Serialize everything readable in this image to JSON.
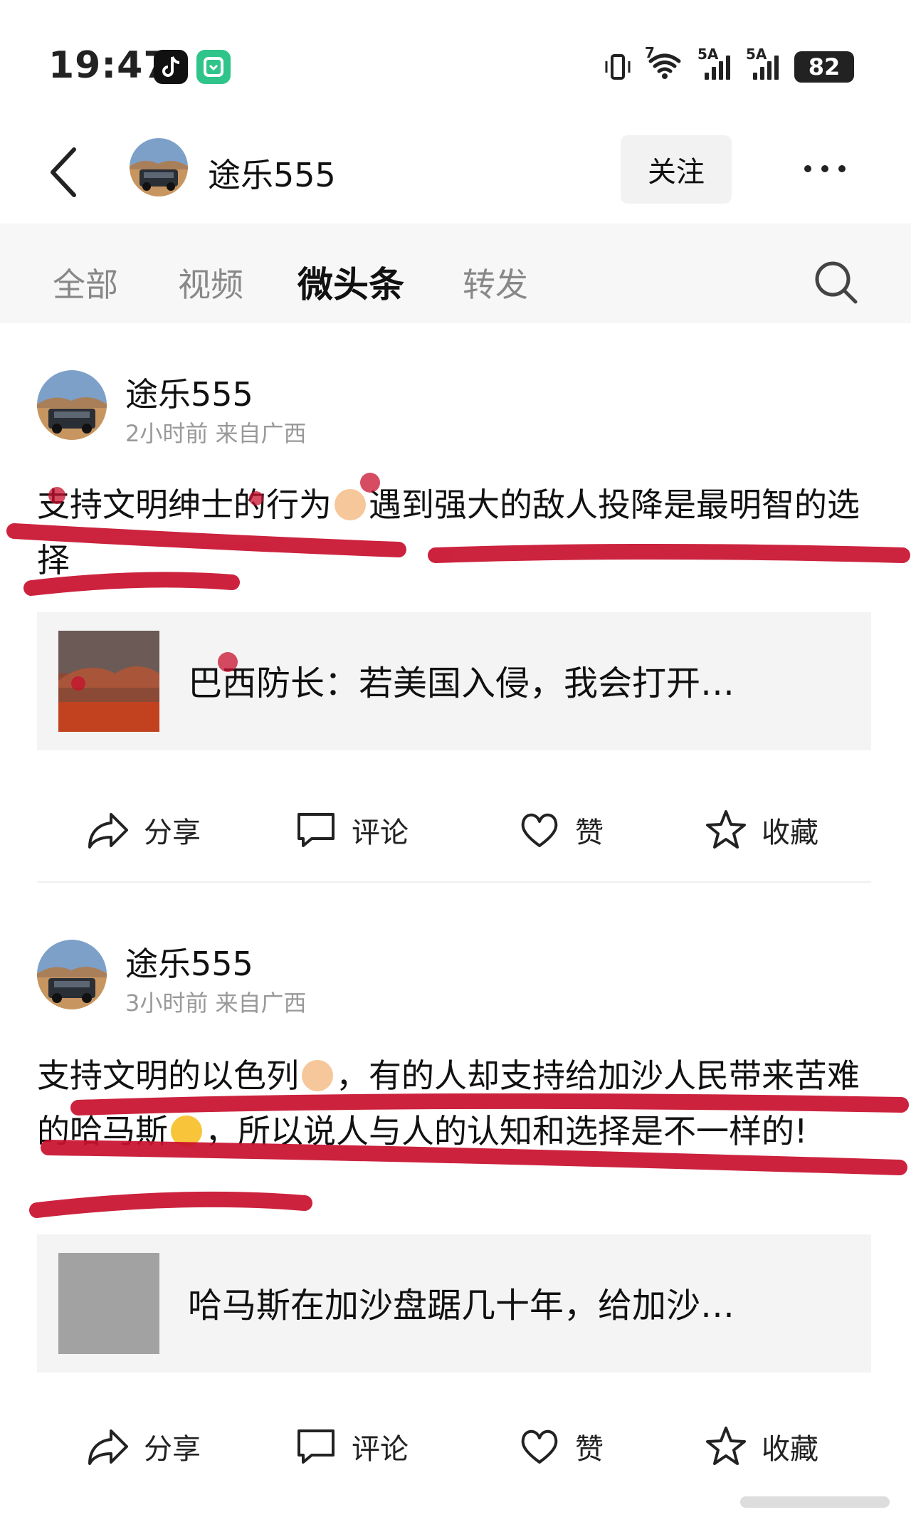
{
  "status_bar": {
    "time": "19:47",
    "network_labels": [
      "7",
      "5A",
      "5A"
    ],
    "battery": "82"
  },
  "header": {
    "author_name": "途乐555",
    "follow_label": "关注",
    "icons": [
      "back-arrow-icon",
      "more-dots-icon"
    ]
  },
  "tabs": {
    "items": [
      "全部",
      "视频",
      "微头条",
      "转发"
    ],
    "active": "微头条",
    "search_icon": "search-icon"
  },
  "posts": [
    {
      "author": "途乐555",
      "meta": "2小时前 来自广西",
      "text_part1": "支持文明绅士的行为",
      "text_part2": "遇到强大的敌人投降是最明智的选择",
      "card_title": "巴西防长：若美国入侵，我会打开…",
      "actions": {
        "share": "分享",
        "comment": "评论",
        "like": "赞",
        "favorite": "收藏"
      }
    },
    {
      "author": "途乐555",
      "meta": "3小时前 来自广西",
      "text_part1": "支持文明的以色列",
      "text_part2": "，有的人却支持给加沙人民带来苦难的哈马斯",
      "text_part3": "，所以说人与人的认知和选择是不一样的!",
      "card_title": "哈马斯在加沙盘踞几十年，给加沙…",
      "actions": {
        "share": "分享",
        "comment": "评论",
        "like": "赞",
        "favorite": "收藏"
      }
    }
  ],
  "colors": {
    "annotation_red": "#c8102e",
    "tab_bg": "#f7f7f7",
    "card_bg": "#f4f4f4"
  }
}
